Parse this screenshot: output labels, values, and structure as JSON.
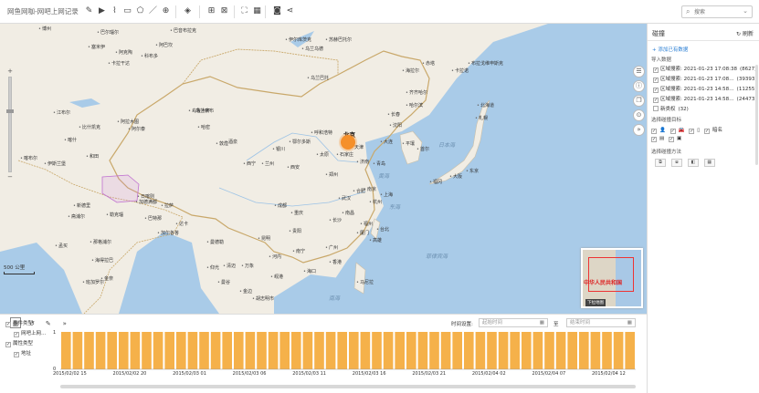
{
  "app": {
    "title": "网鱼网咖-网吧上网记录"
  },
  "toolbar": {
    "icons": [
      "edit-icon",
      "play-icon",
      "lasso-icon",
      "rect-select-icon",
      "polygon-select-icon",
      "line-icon",
      "zoom-icon",
      "layers-icon",
      "select-all-icon",
      "deselect-icon",
      "fullscreen-icon",
      "table-icon",
      "camera-icon",
      "share-icon"
    ],
    "search_placeholder": "搜索"
  },
  "map": {
    "cities": [
      {
        "name": "巴音布拉克",
        "x": 186,
        "y": 4
      },
      {
        "name": "博州",
        "x": 42,
        "y": 2
      },
      {
        "name": "伊尔库茨克",
        "x": 312,
        "y": 14
      },
      {
        "name": "苏赫巴托尔",
        "x": 356,
        "y": 14
      },
      {
        "name": "阿巴坎",
        "x": 170,
        "y": 20
      },
      {
        "name": "科布多",
        "x": 154,
        "y": 32
      },
      {
        "name": "乌兰乌德",
        "x": 330,
        "y": 24
      },
      {
        "name": "巴尔瑙尔",
        "x": 106,
        "y": 6
      },
      {
        "name": "塞米伊",
        "x": 96,
        "y": 22
      },
      {
        "name": "卡拉干达",
        "x": 118,
        "y": 40
      },
      {
        "name": "阿克陶",
        "x": 126,
        "y": 28
      },
      {
        "name": "乌兰巴托",
        "x": 336,
        "y": 56
      },
      {
        "name": "乌兰察布",
        "x": 210,
        "y": 92
      },
      {
        "name": "乌鲁木齐",
        "x": 206,
        "y": 92
      },
      {
        "name": "卡拉诺",
        "x": 494,
        "y": 48
      },
      {
        "name": "赤塔",
        "x": 462,
        "y": 40
      },
      {
        "name": "海拉尔",
        "x": 440,
        "y": 48
      },
      {
        "name": "布拉戈维申斯克",
        "x": 512,
        "y": 40
      },
      {
        "name": "齐齐哈尔",
        "x": 444,
        "y": 72
      },
      {
        "name": "哈尔滨",
        "x": 444,
        "y": 86
      },
      {
        "name": "长春",
        "x": 424,
        "y": 96
      },
      {
        "name": "沈阳",
        "x": 426,
        "y": 108
      },
      {
        "name": "大连",
        "x": 416,
        "y": 126
      },
      {
        "name": "阿尔泰",
        "x": 140,
        "y": 112
      },
      {
        "name": "比什凯克",
        "x": 86,
        "y": 110
      },
      {
        "name": "阿拉木图",
        "x": 128,
        "y": 104
      },
      {
        "name": "江布尔",
        "x": 58,
        "y": 94
      },
      {
        "name": "呼和浩特",
        "x": 340,
        "y": 116
      },
      {
        "name": "太原",
        "x": 346,
        "y": 140
      },
      {
        "name": "石家庄",
        "x": 368,
        "y": 140
      },
      {
        "name": "济南",
        "x": 390,
        "y": 148
      },
      {
        "name": "郑州",
        "x": 356,
        "y": 162
      },
      {
        "name": "西安",
        "x": 314,
        "y": 154
      },
      {
        "name": "兰州",
        "x": 286,
        "y": 150
      },
      {
        "name": "西宁",
        "x": 266,
        "y": 150
      },
      {
        "name": "拉萨",
        "x": 176,
        "y": 196
      },
      {
        "name": "成都",
        "x": 300,
        "y": 196
      },
      {
        "name": "重庆",
        "x": 318,
        "y": 204
      },
      {
        "name": "武汉",
        "x": 370,
        "y": 188
      },
      {
        "name": "南京",
        "x": 398,
        "y": 178
      },
      {
        "name": "上海",
        "x": 416,
        "y": 184
      },
      {
        "name": "长沙",
        "x": 360,
        "y": 212
      },
      {
        "name": "贵阳",
        "x": 316,
        "y": 224
      },
      {
        "name": "昆明",
        "x": 282,
        "y": 232
      },
      {
        "name": "南宁",
        "x": 320,
        "y": 246
      },
      {
        "name": "广州",
        "x": 356,
        "y": 242
      },
      {
        "name": "香港",
        "x": 360,
        "y": 258
      },
      {
        "name": "台北",
        "x": 412,
        "y": 222
      },
      {
        "name": "福州",
        "x": 394,
        "y": 216
      },
      {
        "name": "首尔",
        "x": 456,
        "y": 134
      },
      {
        "name": "平壤",
        "x": 440,
        "y": 128
      },
      {
        "name": "东京",
        "x": 510,
        "y": 158
      },
      {
        "name": "大阪",
        "x": 492,
        "y": 164
      },
      {
        "name": "福冈",
        "x": 470,
        "y": 170
      },
      {
        "name": "札幌",
        "x": 520,
        "y": 100
      },
      {
        "name": "新德里",
        "x": 80,
        "y": 196
      },
      {
        "name": "加德满都",
        "x": 148,
        "y": 192
      },
      {
        "name": "达卡",
        "x": 192,
        "y": 216
      },
      {
        "name": "曼德勒",
        "x": 226,
        "y": 236
      },
      {
        "name": "河内",
        "x": 294,
        "y": 252
      },
      {
        "name": "曼谷",
        "x": 238,
        "y": 280
      },
      {
        "name": "金边",
        "x": 262,
        "y": 290
      },
      {
        "name": "胡志明市",
        "x": 276,
        "y": 298
      },
      {
        "name": "马尼拉",
        "x": 390,
        "y": 280
      },
      {
        "name": "孟买",
        "x": 60,
        "y": 240
      },
      {
        "name": "加尔各答",
        "x": 172,
        "y": 226
      },
      {
        "name": "班加罗尔",
        "x": 90,
        "y": 280
      },
      {
        "name": "金奈",
        "x": 110,
        "y": 276
      },
      {
        "name": "科伦坡",
        "x": 118,
        "y": 318
      },
      {
        "name": "仰光",
        "x": 226,
        "y": 264
      },
      {
        "name": "伊斯兰堡",
        "x": 48,
        "y": 150
      },
      {
        "name": "喀布尔",
        "x": 22,
        "y": 144
      },
      {
        "name": "斋浦尔",
        "x": 74,
        "y": 208
      },
      {
        "name": "勒克瑙",
        "x": 116,
        "y": 206
      },
      {
        "name": "那格浦尔",
        "x": 98,
        "y": 236
      },
      {
        "name": "巴特那",
        "x": 158,
        "y": 210
      },
      {
        "name": "海得拉巴",
        "x": 100,
        "y": 256
      },
      {
        "name": "清迈",
        "x": 244,
        "y": 262
      },
      {
        "name": "万象",
        "x": 264,
        "y": 262
      },
      {
        "name": "岘港",
        "x": 296,
        "y": 274
      },
      {
        "name": "高雄",
        "x": 404,
        "y": 234
      },
      {
        "name": "杭州",
        "x": 404,
        "y": 192
      },
      {
        "name": "海口",
        "x": 332,
        "y": 268
      },
      {
        "name": "南昌",
        "x": 374,
        "y": 204
      },
      {
        "name": "合肥",
        "x": 386,
        "y": 180
      },
      {
        "name": "厦门",
        "x": 390,
        "y": 226
      },
      {
        "name": "喀什",
        "x": 70,
        "y": 124
      },
      {
        "name": "和田",
        "x": 94,
        "y": 142
      },
      {
        "name": "日喀则",
        "x": 150,
        "y": 186
      },
      {
        "name": "鄂尔多斯",
        "x": 316,
        "y": 126
      },
      {
        "name": "银川",
        "x": 298,
        "y": 134
      },
      {
        "name": "哈密",
        "x": 216,
        "y": 110
      },
      {
        "name": "敦煌",
        "x": 236,
        "y": 128
      },
      {
        "name": "酒泉",
        "x": 246,
        "y": 126
      },
      {
        "name": "青岛",
        "x": 408,
        "y": 150
      },
      {
        "name": "天津",
        "x": 384,
        "y": 132
      },
      {
        "name": "北海道",
        "x": 522,
        "y": 86
      }
    ],
    "seas": [
      {
        "name": "日本海",
        "x": 480,
        "y": 128
      },
      {
        "name": "东海",
        "x": 426,
        "y": 196
      },
      {
        "name": "黄海",
        "x": 414,
        "y": 162
      },
      {
        "name": "南海",
        "x": 360,
        "y": 296
      },
      {
        "name": "菲律宾海",
        "x": 466,
        "y": 250
      }
    ],
    "beijing_label": "北京",
    "scale": "500 公里",
    "thumbnail": {
      "label": "中华人民共和国",
      "button": "下拉地图"
    },
    "tools": [
      "list-icon",
      "info-icon",
      "copy-icon",
      "pin-icon",
      "expand-icon"
    ]
  },
  "panel": {
    "title": "碰撞",
    "refresh": "刷新",
    "add_data": "+ 添加已有数据",
    "import_section": "导入数据",
    "data_rows": [
      {
        "label": "区域搜索: 2021-01-23 17:08:38",
        "count": "(8627)",
        "checked": "✓"
      },
      {
        "label": "区域搜索: 2021-01-23 17:08…",
        "count": "(39393)",
        "checked": "✓"
      },
      {
        "label": "区域搜索: 2021-01-23 14:58…",
        "count": "(11255)",
        "checked": "✓"
      },
      {
        "label": "区域搜索: 2021-01-23 14:58…",
        "count": "(24473)",
        "checked": "✓"
      },
      {
        "label": "新类权",
        "count": "(32)",
        "checked": ""
      }
    ],
    "target_section": "选择碰撞目标",
    "targets_row1": [
      "✓",
      "person-icon",
      "✓",
      "car-icon",
      "✓",
      "phone-icon",
      "✓",
      "暗名"
    ],
    "targets_row2": [
      "✓",
      "id-card-icon",
      "✓",
      "screen-icon"
    ],
    "method_section": "选择碰撞方法",
    "methods": [
      "union-icon",
      "intersect-icon",
      "diff-icon",
      "complement-icon"
    ]
  },
  "bottom": {
    "tabs": [
      "chart-icon",
      "history-icon",
      "brush-icon",
      "collapse-icon"
    ],
    "tree": [
      {
        "label": "事件类型",
        "checked": "✓",
        "indent": 0
      },
      {
        "label": "网吧上网…",
        "checked": "✓",
        "indent": 1
      },
      {
        "label": "属性类型",
        "checked": "✓",
        "indent": 0
      },
      {
        "label": "地址",
        "checked": "✓",
        "indent": 1
      }
    ],
    "time_setting_label": "时间设置:",
    "start_placeholder": "起始时间",
    "to_label": "至",
    "end_placeholder": "结束时间"
  },
  "chart_data": {
    "type": "bar",
    "title": "",
    "ylabel": "",
    "ylim": [
      0,
      1
    ],
    "y_ticks": [
      "1",
      "0"
    ],
    "bar_count": 50,
    "values": [
      1,
      1,
      1,
      1,
      1,
      1,
      1,
      1,
      1,
      1,
      1,
      1,
      1,
      1,
      1,
      1,
      1,
      1,
      1,
      1,
      1,
      1,
      1,
      1,
      1,
      1,
      1,
      1,
      1,
      1,
      1,
      1,
      1,
      1,
      1,
      1,
      1,
      1,
      1,
      1,
      1,
      1,
      1,
      1,
      1,
      1,
      1,
      1,
      1,
      1
    ],
    "x_tick_labels": [
      "2015/02/02 15",
      "2015/02/02 20",
      "2015/02/03 01",
      "2015/02/03 06",
      "2015/02/03 11",
      "2015/02/03 16",
      "2015/02/03 21",
      "2015/02/04 02",
      "2015/02/04 07",
      "2015/02/04 12"
    ],
    "color": "#f5b14a"
  }
}
